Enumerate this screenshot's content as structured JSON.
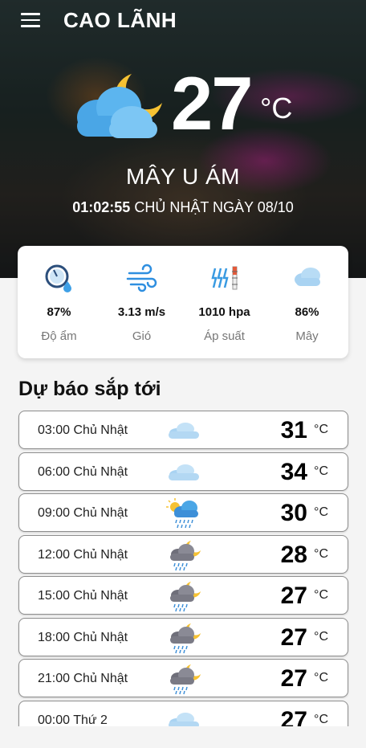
{
  "header": {
    "city": "CAO LÃNH",
    "menu_icon": "hamburger-menu-icon"
  },
  "current": {
    "icon": "cloud-moon-icon",
    "temperature": "27",
    "unit": "°C",
    "condition": "MÂY U ÁM",
    "clock": "01:02:55",
    "date_text": "CHỦ NHẬT NGÀY 08/10"
  },
  "stats": [
    {
      "icon": "humidity-gauge-icon",
      "value": "87%",
      "label": "Độ ẩm"
    },
    {
      "icon": "wind-icon",
      "value": "3.13 m/s",
      "label": "Gió"
    },
    {
      "icon": "pressure-icon",
      "value": "1010 hpa",
      "label": "Áp suất"
    },
    {
      "icon": "cloud-icon",
      "value": "86%",
      "label": "Mây"
    }
  ],
  "forecast_title": "Dự báo sắp tới",
  "forecast": [
    {
      "time": "03:00 Chủ Nhật",
      "temp": "31",
      "unit": "°C",
      "icon": "cloudy-icon"
    },
    {
      "time": "06:00 Chủ Nhật",
      "temp": "34",
      "unit": "°C",
      "icon": "cloudy-icon"
    },
    {
      "time": "09:00 Chủ Nhật",
      "temp": "30",
      "unit": "°C",
      "icon": "sun-rain-icon"
    },
    {
      "time": "12:00 Chủ Nhật",
      "temp": "28",
      "unit": "°C",
      "icon": "moon-cloud-rain-icon"
    },
    {
      "time": "15:00 Chủ Nhật",
      "temp": "27",
      "unit": "°C",
      "icon": "moon-cloud-rain-icon"
    },
    {
      "time": "18:00 Chủ Nhật",
      "temp": "27",
      "unit": "°C",
      "icon": "moon-cloud-rain-icon"
    },
    {
      "time": "21:00 Chủ Nhật",
      "temp": "27",
      "unit": "°C",
      "icon": "moon-cloud-rain-icon"
    },
    {
      "time": "00:00 Thứ 2",
      "temp": "27",
      "unit": "°C",
      "icon": "cloudy-icon"
    }
  ]
}
